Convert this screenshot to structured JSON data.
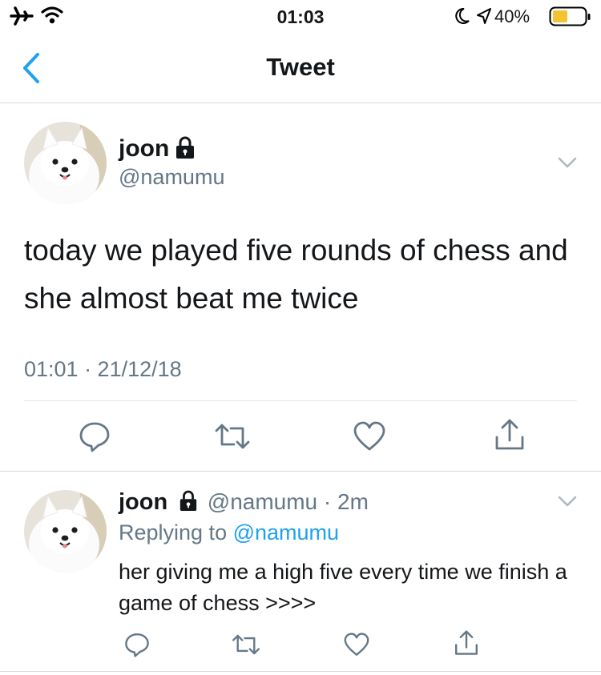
{
  "status_bar": {
    "time": "01:03",
    "battery_percent": "40%",
    "icons": [
      "airplane-icon",
      "wifi-icon",
      "moon-icon",
      "location-arrow-icon",
      "battery-icon"
    ]
  },
  "nav": {
    "title": "Tweet",
    "back_icon": "chevron-left-icon"
  },
  "tweet": {
    "name": "joon",
    "handle": "@namumu",
    "text": "today we played five rounds of chess and she almost beat me twice",
    "timestamp": "01:01 · 21/12/18",
    "actions": [
      "reply-icon",
      "retweet-icon",
      "like-icon",
      "share-icon"
    ]
  },
  "reply": {
    "name": "joon",
    "handle_time": "@namumu · 2m",
    "replying_label": "Replying to",
    "replying_handle": "@namumu",
    "text": "her giving me a high five every time we finish a game of chess >>>>",
    "actions": [
      "reply-icon",
      "retweet-icon",
      "like-icon",
      "share-icon"
    ]
  },
  "colors": {
    "accent": "#1da1f2",
    "muted": "#657786",
    "battery": "#f4c430"
  }
}
